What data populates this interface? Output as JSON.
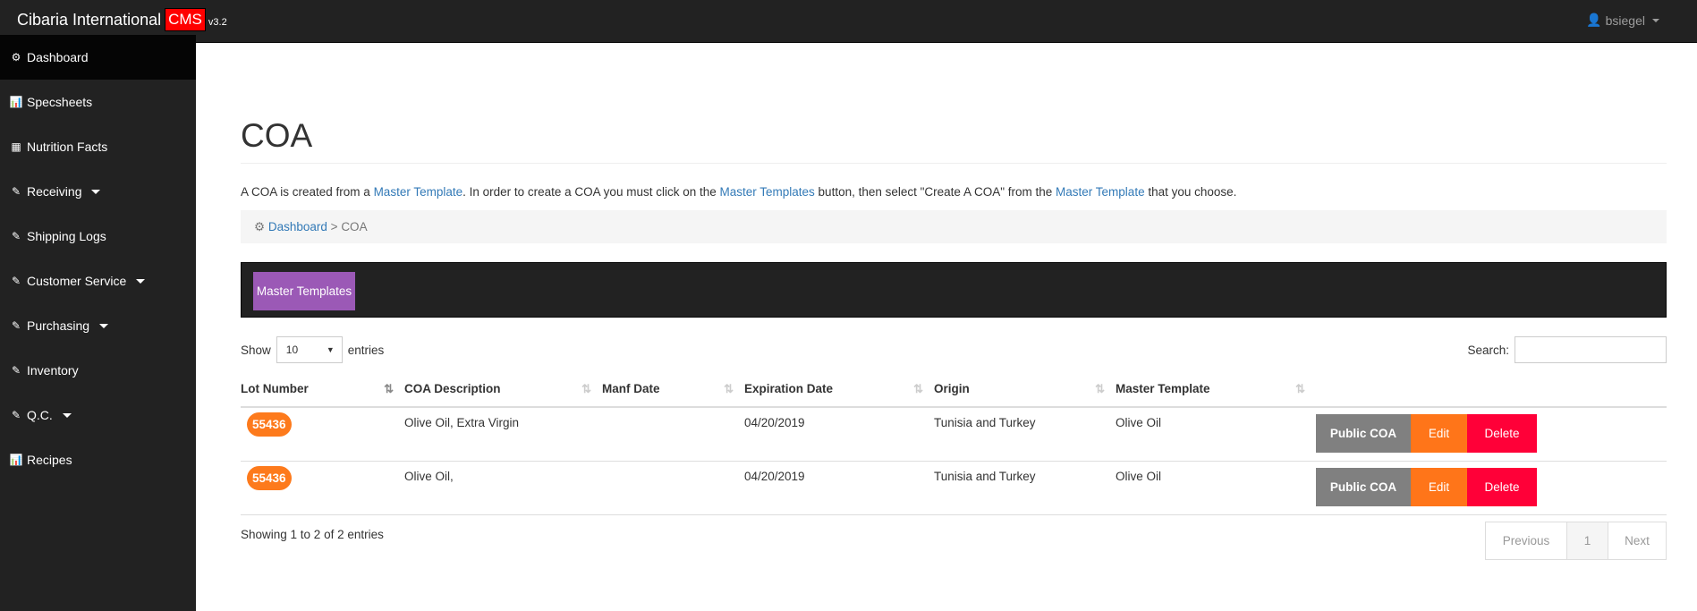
{
  "app": {
    "brand": "Cibaria International",
    "cms": "CMS",
    "version": "v3.2",
    "user": "bsiegel"
  },
  "sidebar": {
    "items": [
      {
        "label": "Dashboard",
        "icon": "dashboard-icon",
        "active": true
      },
      {
        "label": "Specsheets",
        "icon": "bar-chart-icon"
      },
      {
        "label": "Nutrition Facts",
        "icon": "table-icon"
      },
      {
        "label": "Receiving",
        "icon": "edit-icon",
        "dropdown": true
      },
      {
        "label": "Shipping Logs",
        "icon": "edit-icon"
      },
      {
        "label": "Customer Service",
        "icon": "edit-icon",
        "dropdown": true
      },
      {
        "label": "Purchasing",
        "icon": "edit-icon",
        "dropdown": true
      },
      {
        "label": "Inventory",
        "icon": "edit-icon"
      },
      {
        "label": "Q.C.",
        "icon": "edit-icon",
        "dropdown": true
      },
      {
        "label": "Recipes",
        "icon": "bar-chart-icon"
      }
    ]
  },
  "page": {
    "title": "COA",
    "desc": {
      "p1": "A COA is created from a ",
      "l1": "Master Template",
      "p2": ". In order to create a COA you must click on the ",
      "l2": "Master Templates",
      "p3": " button, then select \"Create A COA\" from the ",
      "l3": "Master Template",
      "p4": " that you choose."
    },
    "breadcrumb": {
      "home": "Dashboard",
      "sep": " > ",
      "current": "COA"
    },
    "master_templates_button": "Master Templates"
  },
  "table": {
    "show": "Show",
    "entries_value": "10",
    "entries": "entries",
    "search_label": "Search:",
    "columns": [
      "Lot Number",
      "COA Description",
      "Manf Date",
      "Expiration Date",
      "Origin",
      "Master Template"
    ],
    "rows": [
      {
        "lot": "55436",
        "desc": "Olive Oil, Extra Virgin",
        "manf": "",
        "exp": "04/20/2019",
        "origin": "Tunisia and Turkey",
        "template": "Olive Oil"
      },
      {
        "lot": "55436",
        "desc": "Olive Oil,",
        "manf": "",
        "exp": "04/20/2019",
        "origin": "Tunisia and Turkey",
        "template": "Olive Oil"
      }
    ],
    "actions": {
      "public": "Public COA",
      "edit": "Edit",
      "delete": "Delete"
    },
    "info": "Showing 1 to 2 of 2 entries",
    "pager": {
      "prev": "Previous",
      "page": "1",
      "next": "Next"
    }
  },
  "colors": {
    "accent": "#9b59b6",
    "badge": "#fd7a1c",
    "edit": "#ff7519",
    "delete": "#ff0038",
    "public": "#808080",
    "cms": "#ff0000"
  }
}
